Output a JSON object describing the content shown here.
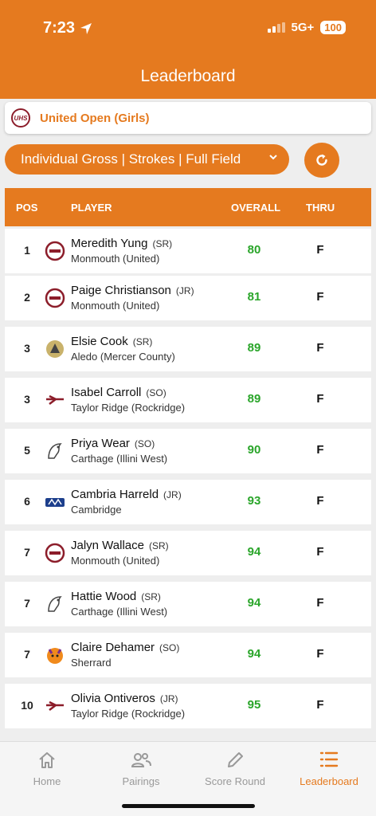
{
  "status": {
    "time": "7:23",
    "network": "5G+",
    "battery": "100"
  },
  "screen_title": "Leaderboard",
  "event": {
    "name": "United Open (Girls)"
  },
  "filter": {
    "label": "Individual Gross | Strokes | Full Field"
  },
  "table": {
    "headers": {
      "pos": "POS",
      "player": "PLAYER",
      "overall": "OVERALL",
      "thru": "THRU"
    },
    "rows": [
      {
        "pos": "1",
        "name": "Meredith Yung",
        "grade": "(SR)",
        "school": "Monmouth (United)",
        "overall": "80",
        "thru": "F",
        "logo": "united-logo"
      },
      {
        "pos": "2",
        "name": "Paige Christianson",
        "grade": "(JR)",
        "school": "Monmouth (United)",
        "overall": "81",
        "thru": "F",
        "logo": "united-logo"
      },
      {
        "pos": "3",
        "name": "Elsie Cook",
        "grade": "(SR)",
        "school": "Aledo (Mercer County)",
        "overall": "89",
        "thru": "F",
        "logo": "mercer-county-logo"
      },
      {
        "pos": "3",
        "name": "Isabel Carroll",
        "grade": "(SO)",
        "school": "Taylor Ridge (Rockridge)",
        "overall": "89",
        "thru": "F",
        "logo": "rockridge-logo"
      },
      {
        "pos": "5",
        "name": "Priya Wear",
        "grade": "(SO)",
        "school": "Carthage (Illini West)",
        "overall": "90",
        "thru": "F",
        "logo": "illini-west-logo"
      },
      {
        "pos": "6",
        "name": "Cambria Harreld",
        "grade": "(JR)",
        "school": "Cambridge",
        "overall": "93",
        "thru": "F",
        "logo": "cambridge-logo"
      },
      {
        "pos": "7",
        "name": "Jalyn Wallace",
        "grade": "(SR)",
        "school": "Monmouth (United)",
        "overall": "94",
        "thru": "F",
        "logo": "united-logo"
      },
      {
        "pos": "7",
        "name": "Hattie Wood",
        "grade": "(SR)",
        "school": "Carthage (Illini West)",
        "overall": "94",
        "thru": "F",
        "logo": "illini-west-logo"
      },
      {
        "pos": "7",
        "name": "Claire Dehamer",
        "grade": "(SO)",
        "school": "Sherrard",
        "overall": "94",
        "thru": "F",
        "logo": "sherrard-logo"
      },
      {
        "pos": "10",
        "name": "Olivia Ontiveros",
        "grade": "(JR)",
        "school": "Taylor Ridge (Rockridge)",
        "overall": "95",
        "thru": "F",
        "logo": "rockridge-logo"
      }
    ]
  },
  "tabs": [
    {
      "label": "Home",
      "icon": "home-icon",
      "active": false
    },
    {
      "label": "Pairings",
      "icon": "people-icon",
      "active": false
    },
    {
      "label": "Score Round",
      "icon": "pencil-icon",
      "active": false
    },
    {
      "label": "Leaderboard",
      "icon": "leaderboard-icon",
      "active": true
    }
  ],
  "colors": {
    "accent": "#e57a1f",
    "score_green": "#2aa52a",
    "united_maroon": "#8c1d2a"
  }
}
